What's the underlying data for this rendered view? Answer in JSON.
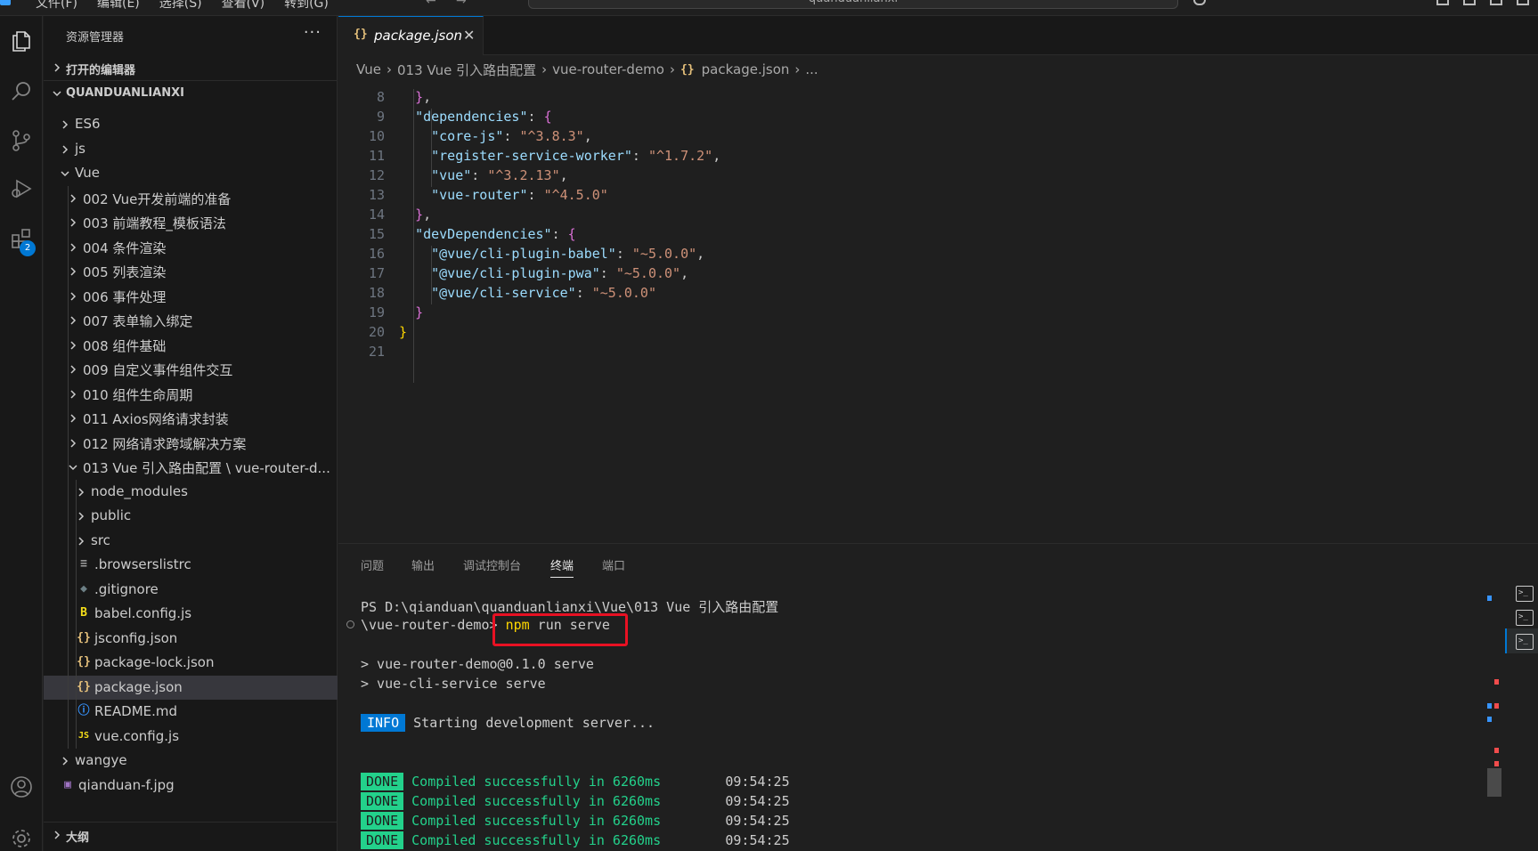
{
  "titlebar": {
    "menus": [
      "文件(F)",
      "编辑(E)",
      "选择(S)",
      "查看(V)",
      "转到(G)"
    ],
    "search_text": "quanduanlianxi"
  },
  "activity": {
    "extensions_badge": "2"
  },
  "explorer": {
    "title": "资源管理器",
    "more": "···",
    "open_editors_label": "打开的编辑器",
    "root_label": "QUANDUANLIANXI",
    "outline_label": "大纲",
    "tree": [
      {
        "label": "ES6",
        "kind": "folder",
        "open": false
      },
      {
        "label": "js",
        "kind": "folder",
        "open": false
      },
      {
        "label": "Vue",
        "kind": "folder",
        "open": true
      },
      {
        "label": "002 Vue开发前端的准备",
        "kind": "folder",
        "open": false
      },
      {
        "label": "003 前端教程_模板语法",
        "kind": "folder",
        "open": false
      },
      {
        "label": "004 条件渲染",
        "kind": "folder",
        "open": false
      },
      {
        "label": "005 列表渲染",
        "kind": "folder",
        "open": false
      },
      {
        "label": "006 事件处理",
        "kind": "folder",
        "open": false
      },
      {
        "label": "007 表单输入绑定",
        "kind": "folder",
        "open": false
      },
      {
        "label": "008 组件基础",
        "kind": "folder",
        "open": false
      },
      {
        "label": "009 自定义事件组件交互",
        "kind": "folder",
        "open": false
      },
      {
        "label": "010 组件生命周期",
        "kind": "folder",
        "open": false
      },
      {
        "label": "011 Axios网络请求封装",
        "kind": "folder",
        "open": false
      },
      {
        "label": "012 网络请求跨域解决方案",
        "kind": "folder",
        "open": false
      },
      {
        "label": "013 Vue 引入路由配置 \\ vue-router-d...",
        "kind": "folder",
        "open": true
      },
      {
        "label": "node_modules",
        "kind": "folder",
        "open": false
      },
      {
        "label": "public",
        "kind": "folder",
        "open": false
      },
      {
        "label": "src",
        "kind": "folder",
        "open": false
      },
      {
        "label": ".browserslistrc",
        "kind": "file",
        "icon": "≡"
      },
      {
        "label": ".gitignore",
        "kind": "file",
        "icon": "◆"
      },
      {
        "label": "babel.config.js",
        "kind": "file",
        "icon": "B"
      },
      {
        "label": "jsconfig.json",
        "kind": "file",
        "icon": "{}"
      },
      {
        "label": "package-lock.json",
        "kind": "file",
        "icon": "{}"
      },
      {
        "label": "package.json",
        "kind": "file",
        "icon": "{}",
        "selected": true
      },
      {
        "label": "README.md",
        "kind": "file",
        "icon": "ⓘ"
      },
      {
        "label": "vue.config.js",
        "kind": "file",
        "icon": "JS"
      },
      {
        "label": "wangye",
        "kind": "folder",
        "open": false
      },
      {
        "label": "qianduan-f.jpg",
        "kind": "file",
        "icon": "▣"
      }
    ]
  },
  "editor": {
    "tab_icon": "{}",
    "tab_label": "package.json",
    "tab_close": "✕",
    "breadcrumb": [
      "Vue",
      "013 Vue 引入路由配置",
      "vue-router-demo",
      "package.json",
      "..."
    ],
    "breadcrumb_icon": "{}",
    "lines": [
      {
        "n": "8"
      },
      {
        "n": "9"
      },
      {
        "n": "10"
      },
      {
        "n": "11"
      },
      {
        "n": "12"
      },
      {
        "n": "13"
      },
      {
        "n": "14"
      },
      {
        "n": "15"
      },
      {
        "n": "16"
      },
      {
        "n": "17"
      },
      {
        "n": "18"
      },
      {
        "n": "19"
      },
      {
        "n": "20"
      },
      {
        "n": "21"
      }
    ],
    "code": {
      "deps_key": "\"dependencies\"",
      "corejs_key": "\"core-js\"",
      "corejs_val": "\"^3.8.3\"",
      "rsw_key": "\"register-service-worker\"",
      "rsw_val": "\"^1.7.2\"",
      "vue_key": "\"vue\"",
      "vue_val": "\"^3.2.13\"",
      "router_key": "\"vue-router\"",
      "router_val": "\"^4.5.0\"",
      "devdeps_key": "\"devDependencies\"",
      "babel_key": "\"@vue/cli-plugin-babel\"",
      "babel_val": "\"~5.0.0\"",
      "pwa_key": "\"@vue/cli-plugin-pwa\"",
      "pwa_val": "\"~5.0.0\"",
      "service_key": "\"@vue/cli-service\"",
      "service_val": "\"~5.0.0\""
    }
  },
  "panel": {
    "tabs": [
      "问题",
      "输出",
      "调试控制台",
      "终端",
      "端口"
    ],
    "active_tab": "终端",
    "terminal": {
      "prompt_line1": "PS D:\\qianduan\\quanduanlianxi\\Vue\\013 Vue 引入路由配置",
      "prompt_line2": "\\vue-router-demo>",
      "cmd_npm": "npm",
      "cmd_rest": " run serve",
      "out1": "> vue-router-demo@0.1.0 serve",
      "out2": "> vue-cli-service serve",
      "info_tag": "INFO",
      "info_text": " Starting development server...",
      "done_tag": "DONE",
      "done_text": " Compiled successfully in 6260ms",
      "done_time": "09:54:25"
    }
  },
  "colors": {
    "accent": "#0078d4",
    "string": "#ce9178",
    "key": "#9cdcfe",
    "done_green": "#23d18b",
    "highlight_red": "#e81123"
  }
}
